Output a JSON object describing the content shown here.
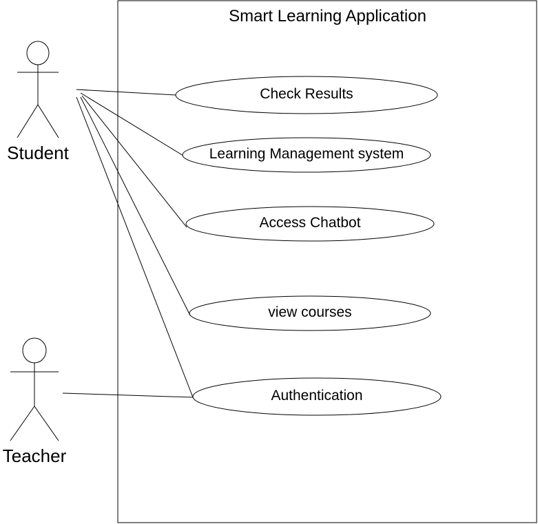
{
  "system": {
    "title": "Smart Learning Application"
  },
  "actors": [
    {
      "id": "student",
      "name": "Student"
    },
    {
      "id": "teacher",
      "name": "Teacher"
    }
  ],
  "use_cases": [
    {
      "id": "check-results",
      "label": "Check Results"
    },
    {
      "id": "lms",
      "label": "Learning Management system"
    },
    {
      "id": "chatbot",
      "label": "Access Chatbot"
    },
    {
      "id": "view-courses",
      "label": "view courses"
    },
    {
      "id": "authentication",
      "label": "Authentication"
    }
  ],
  "associations": [
    {
      "actor": "student",
      "use_case": "check-results"
    },
    {
      "actor": "student",
      "use_case": "lms"
    },
    {
      "actor": "student",
      "use_case": "chatbot"
    },
    {
      "actor": "student",
      "use_case": "view-courses"
    },
    {
      "actor": "student",
      "use_case": "authentication"
    },
    {
      "actor": "teacher",
      "use_case": "authentication"
    }
  ],
  "colors": {
    "stroke": "#000000",
    "fill": "#ffffff",
    "text": "#000000"
  }
}
